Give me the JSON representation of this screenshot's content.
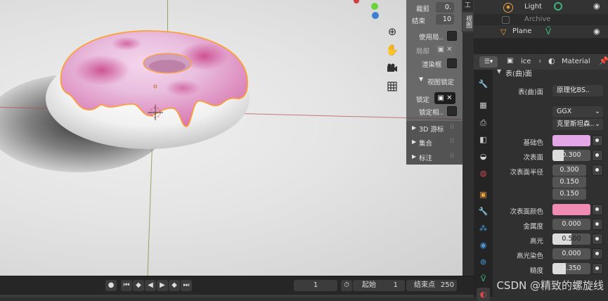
{
  "outliner": {
    "rows": [
      {
        "name": "Light",
        "icon": "light-bulb-icon",
        "active": true
      },
      {
        "name": "Archive",
        "icon": "checkbox-icon",
        "active": false
      },
      {
        "name": "Plane",
        "icon": "mesh-icon",
        "active": true
      }
    ]
  },
  "viewport_panel": {
    "tab_labels": [
      "工",
      "视图"
    ],
    "clip_label": "裁剪",
    "clip_value": "0.",
    "end_label": "结束",
    "end_value": "10",
    "use_local_label": "使用局..",
    "local_label": "局部",
    "render_region_label": "渲染框",
    "view_lock_label": "视图锁定",
    "lock_label": "锁定",
    "lock_relative_label": "锁定相..",
    "sections": [
      "3D 游标",
      "集合",
      "标注"
    ]
  },
  "properties": {
    "breadcrumb": [
      "ice",
      "Material"
    ],
    "section_title": "表(曲)面",
    "surface_label": "表(曲)面",
    "surface_value": "原理化BS..",
    "distribution": "GGX",
    "subsurface_method": "克里斯坦森..",
    "rows": [
      {
        "label": "基础色",
        "kind": "color",
        "color": "#e3a6e6"
      },
      {
        "label": "次表面",
        "kind": "value",
        "value": "0.300"
      },
      {
        "label": "次表面半径",
        "kind": "value",
        "value": "0.300"
      },
      {
        "label": "",
        "kind": "value",
        "value": "0.150"
      },
      {
        "label": "",
        "kind": "value",
        "value": "0.150"
      },
      {
        "label": "次表面颜色",
        "kind": "color",
        "color": "#f08cb4"
      },
      {
        "label": "金属度",
        "kind": "value",
        "value": "0.000"
      },
      {
        "label": "高光",
        "kind": "value",
        "value": "0.500"
      },
      {
        "label": "高光染色",
        "kind": "value",
        "value": "0.000"
      },
      {
        "label": "糙度",
        "kind": "value",
        "value": "0.350"
      }
    ]
  },
  "timeline": {
    "current_frame": "1",
    "start_label": "起始",
    "start_value": "1",
    "end_label": "结束点",
    "end_value": "250"
  },
  "watermark": "CSDN @精致的螺旋线",
  "colors": {
    "accent": "#ffaa33",
    "frosting": "#e8b4d8",
    "selected_outline": "#ff9f2b"
  }
}
